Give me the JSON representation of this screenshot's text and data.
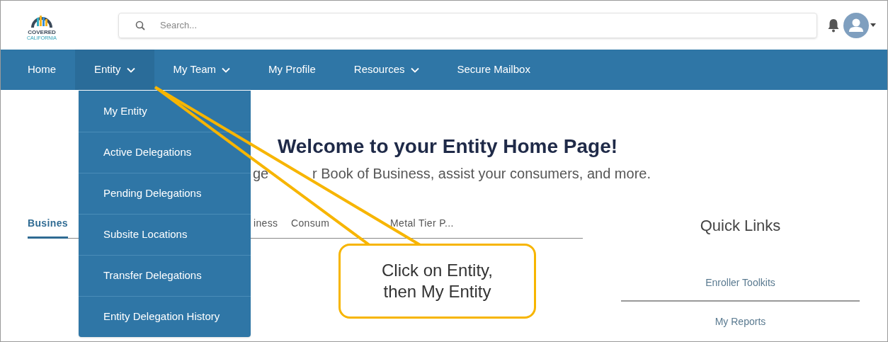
{
  "logo": {
    "line_1": "COVERED",
    "line_2": "CALIFORNIA"
  },
  "search": {
    "placeholder": "Search..."
  },
  "nav": [
    {
      "label": "Home",
      "kind": "link",
      "selected": false
    },
    {
      "label": "Entity",
      "kind": "dropdown",
      "selected": true
    },
    {
      "label": "My Team",
      "kind": "dropdown",
      "selected": false
    },
    {
      "label": "My Profile",
      "kind": "link",
      "selected": false
    },
    {
      "label": "Resources",
      "kind": "dropdown",
      "selected": false
    },
    {
      "label": "Secure Mailbox",
      "kind": "link",
      "selected": false
    }
  ],
  "entity_menu": [
    "My Entity",
    "Active Delegations",
    "Pending Delegations",
    "Subsite Locations",
    "Transfer Delegations",
    "Entity Delegation History"
  ],
  "heading": "Welcome to your Entity Home Page!",
  "subtitle_parts": [
    "ge",
    "r Book of Business, assist your consumers, and more."
  ],
  "tabs": [
    {
      "label": "Busines",
      "selected": true
    },
    {
      "label": "iness",
      "selected": false
    },
    {
      "label": "Consum",
      "selected": false
    },
    {
      "label": "Metal Tier P...",
      "selected": false
    }
  ],
  "quick_links": {
    "title": "Quick Links",
    "links": [
      "Enroller Toolkits",
      "My Reports"
    ]
  },
  "callout": {
    "line_1": "Click on Entity,",
    "line_2": "then My Entity"
  }
}
